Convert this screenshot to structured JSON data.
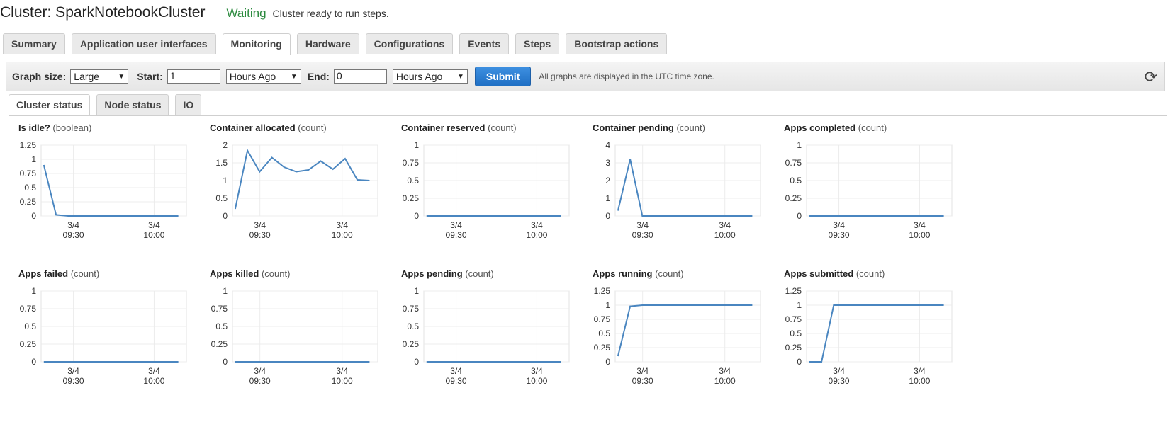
{
  "header": {
    "cluster_title": "Cluster: SparkNotebookCluster",
    "status": "Waiting",
    "status_message": "Cluster ready to run steps.",
    "status_color": "#2b8a3e"
  },
  "tabs": [
    {
      "label": "Summary",
      "active": false
    },
    {
      "label": "Application user interfaces",
      "active": false
    },
    {
      "label": "Monitoring",
      "active": true
    },
    {
      "label": "Hardware",
      "active": false
    },
    {
      "label": "Configurations",
      "active": false
    },
    {
      "label": "Events",
      "active": false
    },
    {
      "label": "Steps",
      "active": false
    },
    {
      "label": "Bootstrap actions",
      "active": false
    }
  ],
  "toolbar": {
    "graph_size_label": "Graph size:",
    "graph_size_value": "Large",
    "start_label": "Start:",
    "start_value": "1",
    "start_unit": "Hours Ago",
    "end_label": "End:",
    "end_value": "0",
    "end_unit": "Hours Ago",
    "submit_label": "Submit",
    "timezone_note": "All graphs are displayed in the UTC time zone.",
    "refresh_icon": "refresh-icon",
    "accent_color": "#1f6fc4"
  },
  "subtabs": [
    {
      "label": "Cluster status",
      "active": true
    },
    {
      "label": "Node status",
      "active": false
    },
    {
      "label": "IO",
      "active": false
    }
  ],
  "chart_data": [
    {
      "type": "line",
      "title": "Is idle?",
      "unit": "(boolean)",
      "yticks": [
        "1.25",
        "1",
        "0.75",
        "0.5",
        "0.25",
        "0"
      ],
      "ylim": [
        0,
        1.25
      ],
      "xticks": [
        [
          "3/4",
          "09:30"
        ],
        [
          "3/4",
          "10:00"
        ]
      ],
      "x_start": "09:18",
      "x_end": "10:12",
      "x_tick_values": [
        "09:30",
        "10:00"
      ],
      "values": [
        0.9,
        0.02,
        0,
        0,
        0,
        0,
        0,
        0,
        0,
        0,
        0,
        0
      ],
      "line_color": "#4a86c0"
    },
    {
      "type": "line",
      "title": "Container allocated",
      "unit": "(count)",
      "yticks": [
        "2",
        "1.5",
        "1",
        "0.5",
        "0"
      ],
      "ylim": [
        0,
        2
      ],
      "xticks": [
        [
          "3/4",
          "09:30"
        ],
        [
          "3/4",
          "10:00"
        ]
      ],
      "x_start": "09:20",
      "x_end": "10:13",
      "x_tick_values": [
        "09:30",
        "10:00"
      ],
      "values": [
        0.2,
        1.85,
        1.25,
        1.65,
        1.38,
        1.25,
        1.3,
        1.55,
        1.32,
        1.62,
        1.02,
        1.0
      ],
      "line_color": "#4a86c0"
    },
    {
      "type": "line",
      "title": "Container reserved",
      "unit": "(count)",
      "yticks": [
        "1",
        "0.75",
        "0.5",
        "0.25",
        "0"
      ],
      "ylim": [
        0,
        1
      ],
      "xticks": [
        [
          "3/4",
          "09:30"
        ],
        [
          "3/4",
          "10:00"
        ]
      ],
      "x_start": "09:18",
      "x_end": "10:12",
      "x_tick_values": [
        "09:30",
        "10:00"
      ],
      "values": [
        0,
        0,
        0,
        0,
        0,
        0,
        0,
        0,
        0,
        0,
        0,
        0
      ],
      "line_color": "#4a86c0"
    },
    {
      "type": "line",
      "title": "Container pending",
      "unit": "(count)",
      "yticks": [
        "4",
        "3",
        "2",
        "1",
        "0"
      ],
      "ylim": [
        0,
        4
      ],
      "xticks": [
        [
          "3/4",
          "09:30"
        ],
        [
          "3/4",
          "10:00"
        ]
      ],
      "x_start": "09:20",
      "x_end": "10:13",
      "x_tick_values": [
        "09:30",
        "10:00"
      ],
      "values": [
        0.3,
        3.2,
        0,
        0,
        0,
        0,
        0,
        0,
        0,
        0,
        0,
        0
      ],
      "line_color": "#4a86c0"
    },
    {
      "type": "line",
      "title": "Apps completed",
      "unit": "(count)",
      "yticks": [
        "1",
        "0.75",
        "0.5",
        "0.25",
        "0"
      ],
      "ylim": [
        0,
        1
      ],
      "xticks": [
        [
          "3/4",
          "09:30"
        ],
        [
          "3/4",
          "10:00"
        ]
      ],
      "x_start": "09:18",
      "x_end": "10:12",
      "x_tick_values": [
        "09:30",
        "10:00"
      ],
      "values": [
        0,
        0,
        0,
        0,
        0,
        0,
        0,
        0,
        0,
        0,
        0,
        0
      ],
      "line_color": "#4a86c0"
    },
    {
      "type": "line",
      "title": "Apps failed",
      "unit": "(count)",
      "yticks": [
        "1",
        "0.75",
        "0.5",
        "0.25",
        "0"
      ],
      "ylim": [
        0,
        1
      ],
      "xticks": [
        [
          "3/4",
          "09:30"
        ],
        [
          "3/4",
          "10:00"
        ]
      ],
      "x_start": "09:18",
      "x_end": "10:12",
      "x_tick_values": [
        "09:30",
        "10:00"
      ],
      "values": [
        0,
        0,
        0,
        0,
        0,
        0,
        0,
        0,
        0,
        0,
        0,
        0
      ],
      "line_color": "#4a86c0"
    },
    {
      "type": "line",
      "title": "Apps killed",
      "unit": "(count)",
      "yticks": [
        "1",
        "0.75",
        "0.5",
        "0.25",
        "0"
      ],
      "ylim": [
        0,
        1
      ],
      "xticks": [
        [
          "3/4",
          "09:30"
        ],
        [
          "3/4",
          "10:00"
        ]
      ],
      "x_start": "09:20",
      "x_end": "10:13",
      "x_tick_values": [
        "09:30",
        "10:00"
      ],
      "values": [
        0,
        0,
        0,
        0,
        0,
        0,
        0,
        0,
        0,
        0,
        0,
        0
      ],
      "line_color": "#4a86c0"
    },
    {
      "type": "line",
      "title": "Apps pending",
      "unit": "(count)",
      "yticks": [
        "1",
        "0.75",
        "0.5",
        "0.25",
        "0"
      ],
      "ylim": [
        0,
        1
      ],
      "xticks": [
        [
          "3/4",
          "09:30"
        ],
        [
          "3/4",
          "10:00"
        ]
      ],
      "x_start": "09:18",
      "x_end": "10:12",
      "x_tick_values": [
        "09:30",
        "10:00"
      ],
      "values": [
        0,
        0,
        0,
        0,
        0,
        0,
        0,
        0,
        0,
        0,
        0,
        0
      ],
      "line_color": "#4a86c0"
    },
    {
      "type": "line",
      "title": "Apps running",
      "unit": "(count)",
      "yticks": [
        "1.25",
        "1",
        "0.75",
        "0.5",
        "0.25",
        "0"
      ],
      "ylim": [
        0,
        1.25
      ],
      "xticks": [
        [
          "3/4",
          "09:30"
        ],
        [
          "3/4",
          "10:00"
        ]
      ],
      "x_start": "09:20",
      "x_end": "10:13",
      "x_tick_values": [
        "09:30",
        "10:00"
      ],
      "values": [
        0.1,
        0.98,
        1,
        1,
        1,
        1,
        1,
        1,
        1,
        1,
        1,
        1
      ],
      "line_color": "#4a86c0"
    },
    {
      "type": "line",
      "title": "Apps submitted",
      "unit": "(count)",
      "yticks": [
        "1.25",
        "1",
        "0.75",
        "0.5",
        "0.25",
        "0"
      ],
      "ylim": [
        0,
        1.25
      ],
      "xticks": [
        [
          "3/4",
          "09:30"
        ],
        [
          "3/4",
          "10:00"
        ]
      ],
      "x_start": "09:18",
      "x_end": "10:12",
      "x_tick_values": [
        "09:30",
        "10:00"
      ],
      "values": [
        0,
        0,
        1,
        1,
        1,
        1,
        1,
        1,
        1,
        1,
        1,
        1
      ],
      "line_color": "#4a86c0"
    }
  ]
}
